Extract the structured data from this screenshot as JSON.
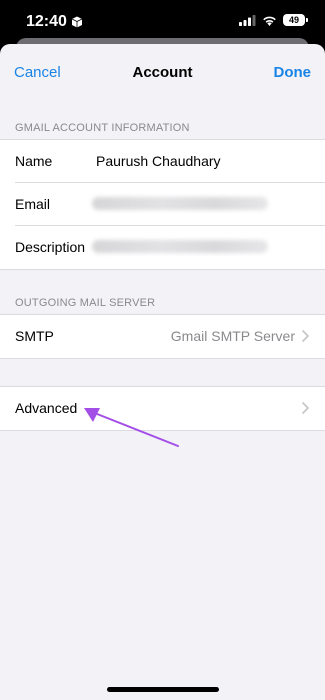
{
  "status_bar": {
    "time": "12:40",
    "battery": "49"
  },
  "nav": {
    "cancel": "Cancel",
    "title": "Account",
    "done": "Done"
  },
  "account_section": {
    "header": "GMAIL ACCOUNT INFORMATION",
    "rows": [
      {
        "label": "Name",
        "value": "Paurush Chaudhary"
      },
      {
        "label": "Email",
        "value": ""
      },
      {
        "label": "Description",
        "value": ""
      }
    ]
  },
  "smtp_section": {
    "header": "OUTGOING MAIL SERVER",
    "row": {
      "label": "SMTP",
      "value": "Gmail SMTP Server"
    }
  },
  "advanced": {
    "label": "Advanced"
  },
  "colors": {
    "accent": "#1a84e6",
    "annotation_arrow": "#a44ee8"
  }
}
